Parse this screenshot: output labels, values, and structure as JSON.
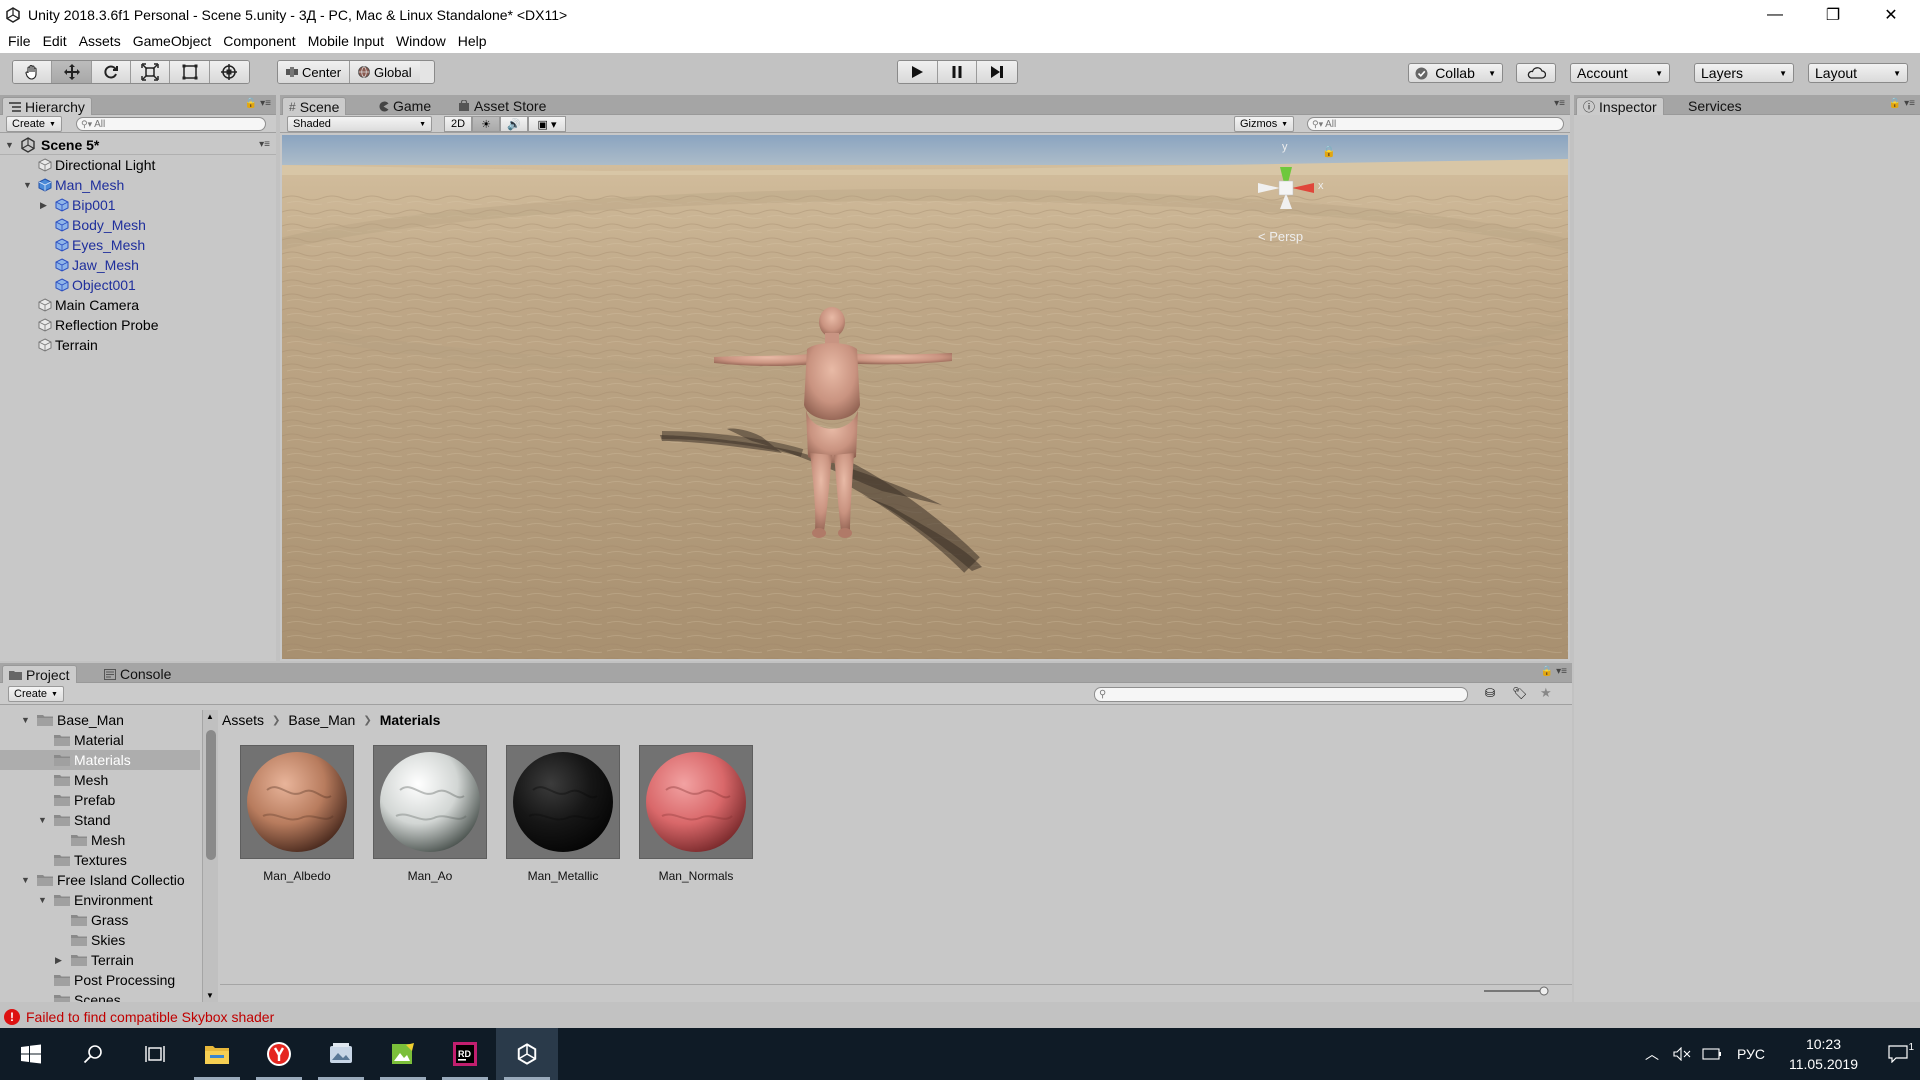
{
  "window": {
    "title": "Unity 2018.3.6f1 Personal - Scene 5.unity - 3Д - PC, Mac & Linux Standalone* <DX11>",
    "minimize": "—",
    "maximize": "❐",
    "close": "✕"
  },
  "menu": [
    "File",
    "Edit",
    "Assets",
    "GameObject",
    "Component",
    "Mobile Input",
    "Window",
    "Help"
  ],
  "toolbar": {
    "pivot_center": "Center",
    "pivot_global": "Global",
    "collab": "Collab",
    "account": "Account",
    "layers": "Layers",
    "layout": "Layout"
  },
  "hierarchy": {
    "tab": "Hierarchy",
    "create": "Create",
    "search_placeholder": "All",
    "scene_name": "Scene 5*",
    "items": [
      {
        "label": "Directional Light",
        "depth": 1,
        "arrow": "",
        "blue": false
      },
      {
        "label": "Man_Mesh",
        "depth": 1,
        "arrow": "down",
        "blue": true
      },
      {
        "label": "Bip001",
        "depth": 2,
        "arrow": "right",
        "blue": true
      },
      {
        "label": "Body_Mesh",
        "depth": 2,
        "arrow": "",
        "blue": true
      },
      {
        "label": "Eyes_Mesh",
        "depth": 2,
        "arrow": "",
        "blue": true
      },
      {
        "label": "Jaw_Mesh",
        "depth": 2,
        "arrow": "",
        "blue": true
      },
      {
        "label": "Object001",
        "depth": 2,
        "arrow": "",
        "blue": true
      },
      {
        "label": "Main Camera",
        "depth": 1,
        "arrow": "",
        "blue": false
      },
      {
        "label": "Reflection Probe",
        "depth": 1,
        "arrow": "",
        "blue": false
      },
      {
        "label": "Terrain",
        "depth": 1,
        "arrow": "",
        "blue": false
      }
    ]
  },
  "scene": {
    "tabs": [
      "Scene",
      "Game",
      "Asset Store"
    ],
    "shading": "Shaded",
    "mode_2d": "2D",
    "gizmos": "Gizmos",
    "search_placeholder": "All",
    "persp_label": "< Persp",
    "axis_y": "y",
    "axis_x": "x"
  },
  "inspector": {
    "tabs": [
      "Inspector",
      "Services"
    ]
  },
  "project": {
    "tabs": [
      "Project",
      "Console"
    ],
    "create": "Create",
    "breadcrumb": [
      "Assets",
      "Base_Man",
      "Materials"
    ],
    "tree": [
      {
        "label": "Base_Man",
        "depth": 1,
        "arrow": "down",
        "selected": false
      },
      {
        "label": "Material",
        "depth": 2,
        "arrow": "",
        "selected": false
      },
      {
        "label": "Materials",
        "depth": 2,
        "arrow": "",
        "selected": true
      },
      {
        "label": "Mesh",
        "depth": 2,
        "arrow": "",
        "selected": false
      },
      {
        "label": "Prefab",
        "depth": 2,
        "arrow": "",
        "selected": false
      },
      {
        "label": "Stand",
        "depth": 2,
        "arrow": "down",
        "selected": false
      },
      {
        "label": "Mesh",
        "depth": 3,
        "arrow": "",
        "selected": false
      },
      {
        "label": "Textures",
        "depth": 2,
        "arrow": "",
        "selected": false
      },
      {
        "label": "Free Island Collectio",
        "depth": 1,
        "arrow": "down",
        "selected": false
      },
      {
        "label": "Environment",
        "depth": 2,
        "arrow": "down",
        "selected": false
      },
      {
        "label": "Grass",
        "depth": 3,
        "arrow": "",
        "selected": false
      },
      {
        "label": "Skies",
        "depth": 3,
        "arrow": "",
        "selected": false
      },
      {
        "label": "Terrain",
        "depth": 3,
        "arrow": "right",
        "selected": false
      },
      {
        "label": "Post Processing",
        "depth": 2,
        "arrow": "",
        "selected": false
      },
      {
        "label": "Scenes",
        "depth": 2,
        "arrow": "",
        "selected": false
      }
    ],
    "assets": [
      {
        "label": "Man_Albedo",
        "color_light": "#e8b49a",
        "color_mid": "#b87c5e",
        "color_dark": "#4a2a1e"
      },
      {
        "label": "Man_Ao",
        "color_light": "#ffffff",
        "color_mid": "#d2d6d4",
        "color_dark": "#4c5450"
      },
      {
        "label": "Man_Metallic",
        "color_light": "#3c3c3c",
        "color_mid": "#161616",
        "color_dark": "#050505"
      },
      {
        "label": "Man_Normals",
        "color_light": "#f2a2a2",
        "color_mid": "#d9686a",
        "color_dark": "#7a2a2c"
      }
    ]
  },
  "status": {
    "message": "Failed to find compatible Skybox shader"
  },
  "taskbar": {
    "lang": "РУС",
    "time": "10:23",
    "date": "11.05.2019",
    "notif_count": "1"
  }
}
